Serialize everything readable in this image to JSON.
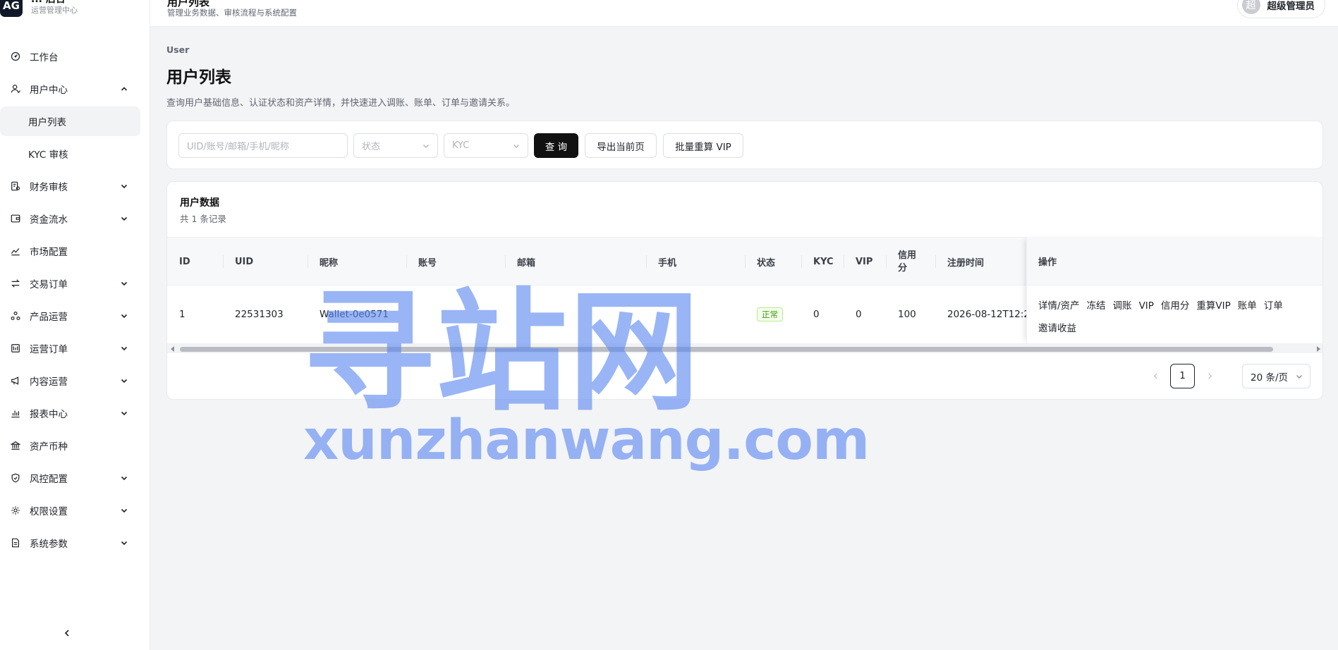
{
  "brand": {
    "logo": "AG",
    "title": "... 后台",
    "subtitle": "运营管理中心"
  },
  "topbar": {
    "title": "用户列表",
    "subtitle": "管理业务数据、审核流程与系统配置",
    "user_avatar": "超",
    "user_name": "超级管理员"
  },
  "sidebar": {
    "items": [
      {
        "label": "工作台",
        "icon": "dashboard-icon",
        "expandable": false
      },
      {
        "label": "用户中心",
        "icon": "user-icon",
        "expandable": true,
        "expanded": true,
        "children": [
          {
            "label": "用户列表",
            "active": true
          },
          {
            "label": "KYC 审核",
            "active": false
          }
        ]
      },
      {
        "label": "财务审核",
        "icon": "finance-icon",
        "expandable": true
      },
      {
        "label": "资金流水",
        "icon": "wallet-icon",
        "expandable": true
      },
      {
        "label": "市场配置",
        "icon": "chart-line-icon",
        "expandable": false
      },
      {
        "label": "交易订单",
        "icon": "swap-icon",
        "expandable": true
      },
      {
        "label": "产品运营",
        "icon": "cluster-icon",
        "expandable": true
      },
      {
        "label": "运营订单",
        "icon": "order-icon",
        "expandable": true
      },
      {
        "label": "内容运营",
        "icon": "megaphone-icon",
        "expandable": true
      },
      {
        "label": "报表中心",
        "icon": "bar-chart-icon",
        "expandable": true
      },
      {
        "label": "资产币种",
        "icon": "bank-icon",
        "expandable": false
      },
      {
        "label": "风控配置",
        "icon": "shield-icon",
        "expandable": true
      },
      {
        "label": "权限设置",
        "icon": "gear-icon",
        "expandable": true
      },
      {
        "label": "系统参数",
        "icon": "file-icon",
        "expandable": true
      }
    ],
    "collapse_icon": "chevron-left-icon"
  },
  "page": {
    "breadcrumb": "User",
    "title": "用户列表",
    "description": "查询用户基础信息、认证状态和资产详情，并快速进入调账、账单、订单与邀请关系。"
  },
  "filters": {
    "search_placeholder": "UID/账号/邮箱/手机/昵称",
    "status_placeholder": "状态",
    "kyc_placeholder": "KYC",
    "query_button": "查 询",
    "export_button": "导出当前页",
    "recalc_button": "批量重算 VIP"
  },
  "table": {
    "title": "用户数据",
    "count_text": "共 1 条记录",
    "columns": [
      "ID",
      "UID",
      "昵称",
      "账号",
      "邮箱",
      "手机",
      "状态",
      "KYC",
      "VIP",
      "信用分",
      "注册时间",
      "操作"
    ],
    "rows": [
      {
        "id": "1",
        "uid": "22531303",
        "nickname": "Wallet-0e0571",
        "account": "",
        "email": "",
        "phone": "",
        "status": "正常",
        "kyc": "0",
        "vip": "0",
        "credit": "100",
        "registered": "2026-08-12T12:2"
      }
    ],
    "actions": [
      "详情/资产",
      "冻结",
      "调账",
      "VIP",
      "信用分",
      "重算VIP",
      "账单",
      "订单",
      "邀请收益"
    ]
  },
  "pagination": {
    "current_page": "1",
    "page_size": "20 条/页"
  },
  "watermark": {
    "cn": "寻站网",
    "en": "xunzhanwang.com"
  },
  "colors": {
    "primary": "#111111",
    "status_tag": "#389e0d",
    "watermark": "#5a87f0"
  }
}
